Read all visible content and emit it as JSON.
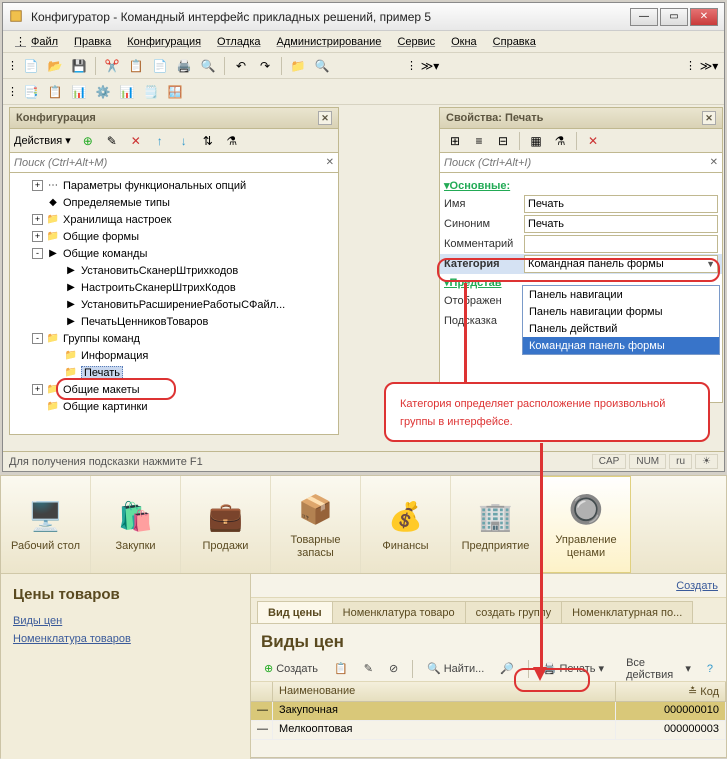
{
  "window": {
    "title": "Конфигуратор - Командный интерфейс прикладных решений, пример 5"
  },
  "menu": {
    "file": "Файл",
    "edit": "Правка",
    "config": "Конфигурация",
    "debug": "Отладка",
    "admin": "Администрирование",
    "service": "Сервис",
    "windows": "Окна",
    "help": "Справка"
  },
  "left_panel": {
    "title": "Конфигурация",
    "actions_label": "Действия ▾",
    "search_placeholder": "Поиск (Ctrl+Alt+M)",
    "tree": [
      {
        "indent": 1,
        "exp": "+",
        "ico": "⋯",
        "label": "Параметры функциональных опций"
      },
      {
        "indent": 1,
        "exp": "",
        "ico": "◆",
        "label": "Определяемые типы"
      },
      {
        "indent": 1,
        "exp": "+",
        "ico": "📁",
        "label": "Хранилища настроек"
      },
      {
        "indent": 1,
        "exp": "+",
        "ico": "📁",
        "label": "Общие формы"
      },
      {
        "indent": 1,
        "exp": "-",
        "ico": "▶",
        "label": "Общие команды"
      },
      {
        "indent": 2,
        "exp": "",
        "ico": "▶",
        "label": "УстановитьСканерШтрихкодов"
      },
      {
        "indent": 2,
        "exp": "",
        "ico": "▶",
        "label": "НастроитьСканерШтрихКодов"
      },
      {
        "indent": 2,
        "exp": "",
        "ico": "▶",
        "label": "УстановитьРасширениеРаботыСФайл..."
      },
      {
        "indent": 2,
        "exp": "",
        "ico": "▶",
        "label": "ПечатьЦенниковТоваров"
      },
      {
        "indent": 1,
        "exp": "-",
        "ico": "📁",
        "label": "Группы команд"
      },
      {
        "indent": 2,
        "exp": "",
        "ico": "📁",
        "label": "Информация"
      },
      {
        "indent": 2,
        "exp": "",
        "ico": "📁",
        "label": "Печать",
        "selected": true
      },
      {
        "indent": 1,
        "exp": "+",
        "ico": "📁",
        "label": "Общие макеты"
      },
      {
        "indent": 1,
        "exp": "",
        "ico": "📁",
        "label": "Общие картинки"
      }
    ]
  },
  "right_panel": {
    "title": "Свойства: Печать",
    "search_placeholder": "Поиск (Ctrl+Alt+I)",
    "section_main": "Основные:",
    "rows": {
      "name_k": "Имя",
      "name_v": "Печать",
      "syn_k": "Синоним",
      "syn_v": "Печать",
      "comm_k": "Комментарий",
      "comm_v": "",
      "cat_k": "Категория",
      "cat_v": "Командная панель формы"
    },
    "section_pres": "Представ",
    "other_rows": {
      "disp_k": "Отображен",
      "hint_k": "Подсказка"
    },
    "dropdown": {
      "opt1": "Панель навигации",
      "opt2": "Панель навигации формы",
      "opt3": "Панель действий",
      "opt4": "Командная панель формы"
    }
  },
  "statusbar": {
    "hint": "Для получения подсказки нажмите F1",
    "cap": "CAP",
    "num": "NUM",
    "lang": "ru"
  },
  "callout": {
    "text": "Категория определяет расположе­ние произвольной группы в интерфейсе."
  },
  "lower": {
    "nav": [
      {
        "ico": "🖥️",
        "label": "Рабочий стол"
      },
      {
        "ico": "🛍️",
        "label": "Закупки"
      },
      {
        "ico": "💼",
        "label": "Продажи"
      },
      {
        "ico": "📦",
        "label": "Товарные запасы"
      },
      {
        "ico": "💰",
        "label": "Финансы"
      },
      {
        "ico": "🏢",
        "label": "Предприятие"
      },
      {
        "ico": "🔘",
        "label": "Управление ценами",
        "active": true
      }
    ],
    "left": {
      "title": "Цены товаров",
      "link1": "Виды цен",
      "link2": "Номенклатура товаров"
    },
    "tabs": {
      "t1": "Вид цены",
      "t2": "Номенклатура товаро",
      "t3": "создать группу",
      "t4": "Номенклатурная по..."
    },
    "subhdr": {
      "create": "Создать"
    },
    "title": "Виды цен",
    "actions": {
      "create": "Создать",
      "find": "Найти...",
      "print": "Печать",
      "all": "Все действия"
    },
    "grid": {
      "h1": "Наименование",
      "h2": "Код",
      "rows": [
        {
          "name": "Закупочная",
          "code": "000000010",
          "sel": true
        },
        {
          "name": "Мелкооптовая",
          "code": "000000003"
        }
      ]
    }
  }
}
